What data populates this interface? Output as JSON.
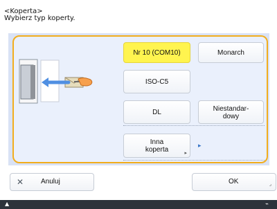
{
  "header": {
    "title": "<Koperta>",
    "subtitle": "Wybierz typ koperty."
  },
  "illustration": {
    "icon": "envelope-feed-illustration"
  },
  "options": {
    "nr10": "Nr 10 (COM10)",
    "monarch": "Monarch",
    "isoc5": "ISO-C5",
    "dl": "DL",
    "custom_line1": "Niestandar-",
    "custom_line2": "dowy",
    "other_line1": "Inna",
    "other_line2": "koperta"
  },
  "footer": {
    "cancel_icon": "✕",
    "cancel_label": "Anuluj",
    "ok_label": "OK"
  },
  "status_bar": {
    "left_icon": "▲",
    "right_icon": "⌁"
  },
  "colors": {
    "selected": "#fff44f",
    "frame": "#f2ad1c",
    "panel": "#d9e2f5",
    "accent": "#3875c7",
    "status_bar": "#2d333b"
  }
}
